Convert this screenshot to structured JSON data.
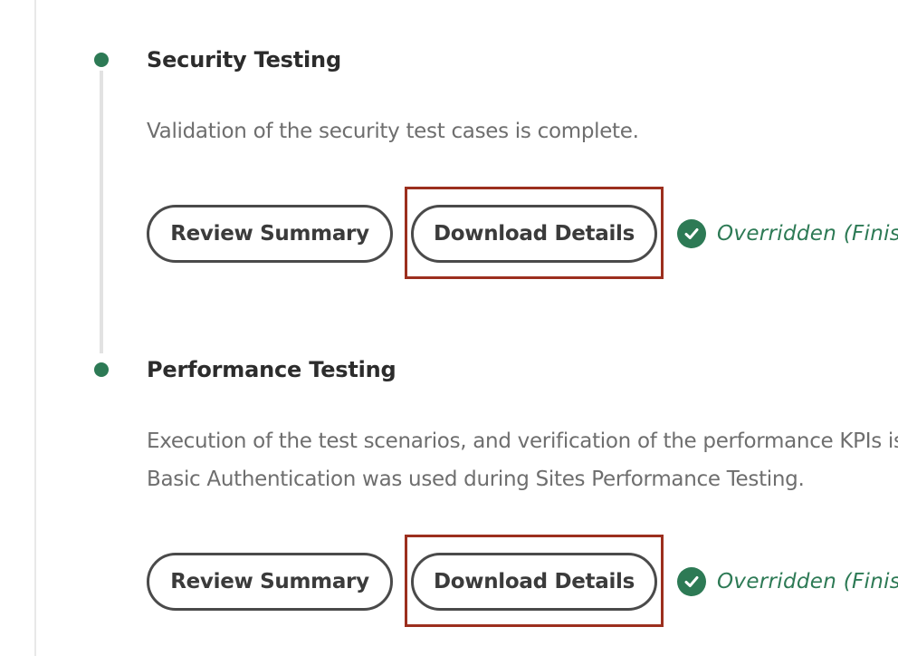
{
  "sections": [
    {
      "title": "Security Testing",
      "description_lines": [
        "Validation of the security test cases is complete."
      ],
      "review_button": "Review Summary",
      "download_button": "Download Details",
      "status": "Overridden  (Finish"
    },
    {
      "title": "Performance Testing",
      "description_lines": [
        "Execution of the test scenarios, and verification of the performance KPIs is",
        "Basic Authentication was used during Sites Performance Testing."
      ],
      "review_button": "Review Summary",
      "download_button": "Download Details",
      "status": "Overridden  (Finish"
    }
  ],
  "colors": {
    "accent_green": "#2d7a55",
    "highlight_red": "#9c2f1e",
    "text_dark": "#2c2c2c",
    "text_muted": "#6e6e6e"
  },
  "icons": {
    "status": "checkmark-circle-icon",
    "timeline": "timeline-dot-icon"
  }
}
